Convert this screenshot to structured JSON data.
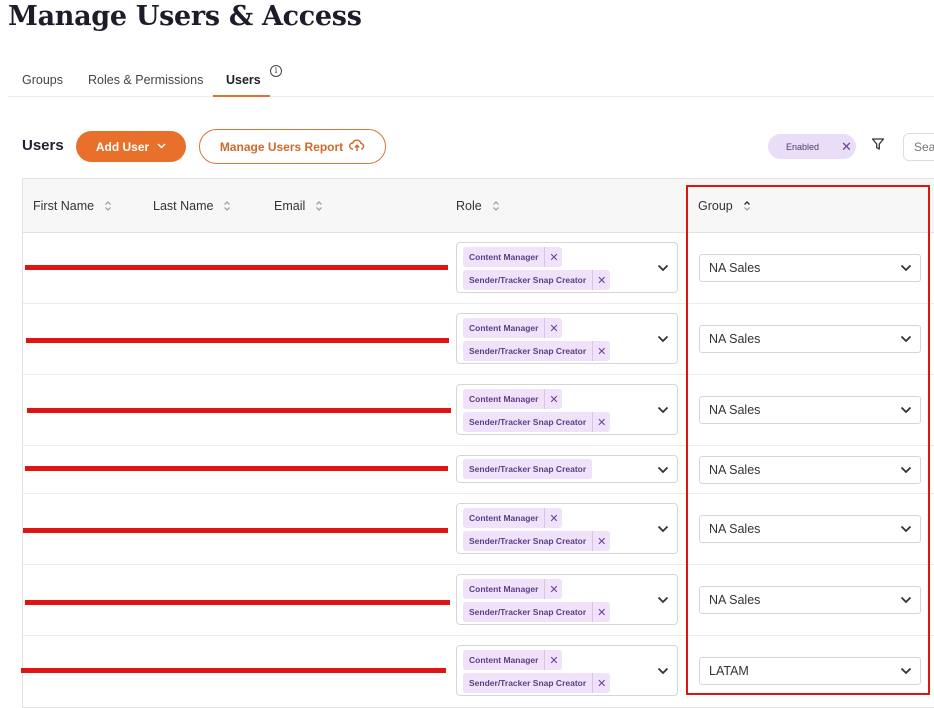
{
  "page": {
    "title": "Manage Users & Access"
  },
  "tabs": [
    {
      "label": "Groups",
      "active": false
    },
    {
      "label": "Roles & Permissions",
      "active": false
    },
    {
      "label": "Users",
      "active": true
    }
  ],
  "tab_info_glyph": "i",
  "toolbar": {
    "section_title": "Users",
    "add_user_label": "Add User",
    "report_label": "Manage Users Report",
    "filter_chip_label": "Enabled",
    "search_placeholder": "Search"
  },
  "table": {
    "columns": [
      "First Name",
      "Last Name",
      "Email",
      "Role",
      "Group"
    ],
    "rows": [
      {
        "roles": [
          "Content Manager",
          "Sender/Tracker Snap Creator"
        ],
        "group": "NA Sales"
      },
      {
        "roles": [
          "Content Manager",
          "Sender/Tracker Snap Creator"
        ],
        "group": "NA Sales"
      },
      {
        "roles": [
          "Content Manager",
          "Sender/Tracker Snap Creator"
        ],
        "group": "NA Sales"
      },
      {
        "roles": [
          "Sender/Tracker Snap Creator"
        ],
        "group": "NA Sales"
      },
      {
        "roles": [
          "Content Manager",
          "Sender/Tracker Snap Creator"
        ],
        "group": "NA Sales"
      },
      {
        "roles": [
          "Content Manager",
          "Sender/Tracker Snap Creator"
        ],
        "group": "NA Sales"
      },
      {
        "roles": [
          "Content Manager",
          "Sender/Tracker Snap Creator"
        ],
        "group": "LATAM"
      }
    ]
  },
  "colors": {
    "accent": "#e8702a",
    "chip_bg": "#efe2fa",
    "annotation": "#e11414"
  },
  "icons": [
    "info-icon",
    "chevron-down-icon",
    "cloud-upload-icon",
    "close-icon",
    "funnel-icon",
    "sort-icon"
  ]
}
